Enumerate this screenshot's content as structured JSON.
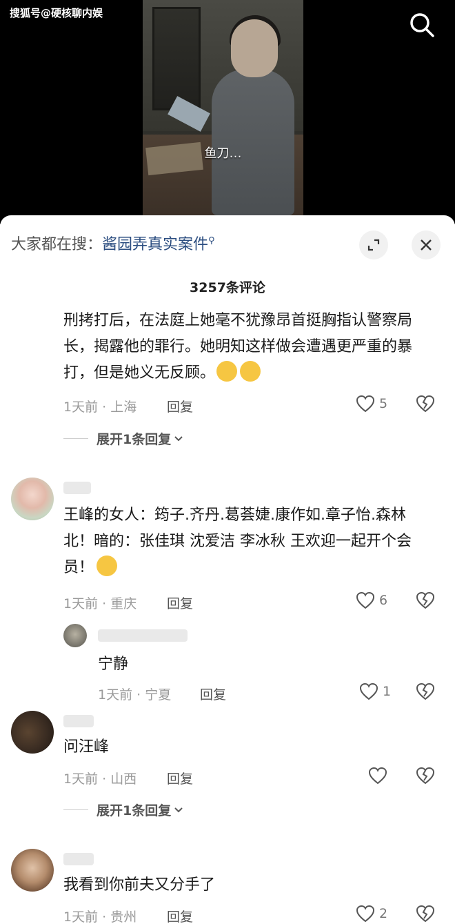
{
  "watermark": "搜狐号@硬核聊内娱",
  "video": {
    "subtitle": "鱼刀…"
  },
  "hot_search": {
    "prefix": "大家都在搜：",
    "term": "酱园弄真实案件"
  },
  "comment_count": "3257条评论",
  "comments": [
    {
      "text": "刑拷打后，在法庭上她毫不犹豫昂首挺胸指认警察局长，揭露他的罪行。她明知这样做会遭遇更严重的暴打，但是她义无反顾。",
      "meta": "1天前 · 上海",
      "reply_label": "回复",
      "likes": "5",
      "expand_label": "展开1条回复"
    },
    {
      "text": "王峰的女人：筠子.齐丹.葛荟婕.康作如.章子怡.森林北！暗的：张佳琪 沈爱洁 李冰秋 王欢迎一起开个会员！",
      "meta": "1天前 · 重庆",
      "reply_label": "回复",
      "likes": "6"
    },
    {
      "text": "宁静",
      "meta": "1天前 · 宁夏",
      "reply_label": "回复",
      "likes": "1"
    },
    {
      "text": "问汪峰",
      "meta": "1天前 · 山西",
      "reply_label": "回复",
      "likes": "",
      "expand_label": "展开1条回复"
    },
    {
      "text": "我看到你前夫又分手了",
      "meta": "1天前 · 贵州",
      "reply_label": "回复",
      "likes": "2"
    }
  ],
  "colors": {
    "link": "#2b4d80",
    "muted": "#9a9a9a",
    "sheet": "#ffffff"
  },
  "icons": [
    "search-icon",
    "expand-icon",
    "close-icon",
    "heart-icon",
    "broken-heart-icon",
    "chevron-down-icon",
    "emoji-icon"
  ]
}
